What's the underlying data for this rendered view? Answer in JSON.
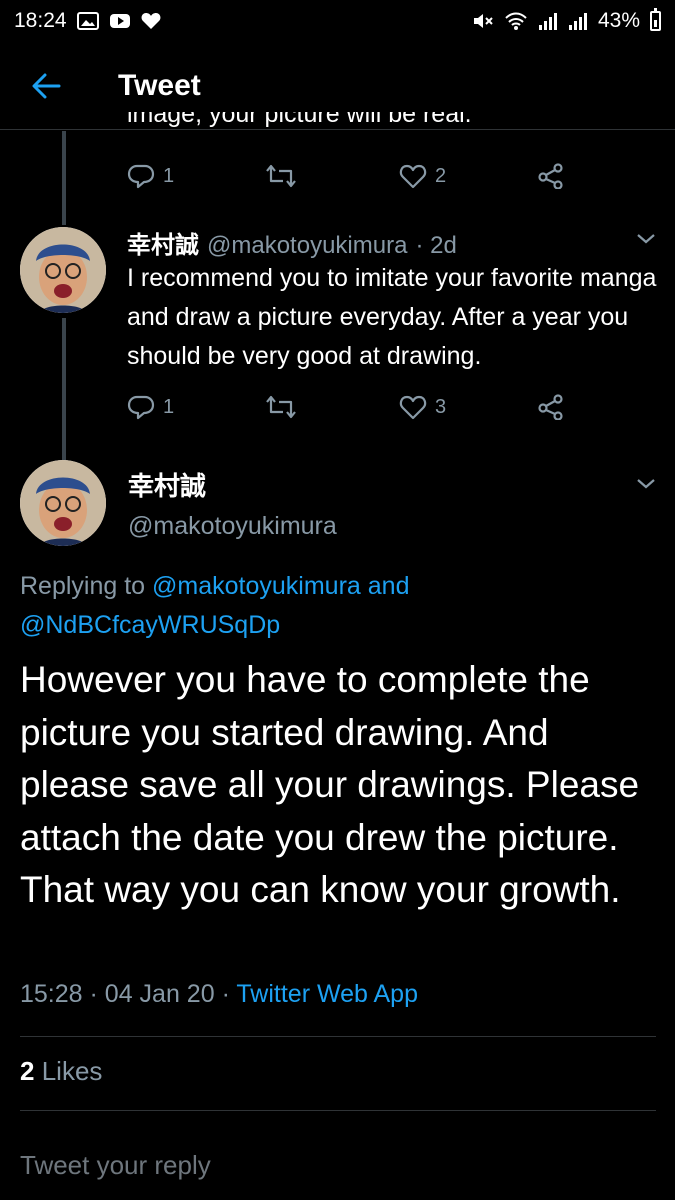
{
  "status_bar": {
    "time": "18:24",
    "battery": "43%",
    "left_icons": [
      "gallery-icon",
      "youtube-icon",
      "heart-icon"
    ],
    "right_icons": [
      "mute-icon",
      "wifi-icon",
      "signal-icon",
      "signal-icon",
      "battery-icon"
    ]
  },
  "header": {
    "title": "Tweet",
    "back_icon": "arrow-left-icon"
  },
  "colors": {
    "background": "#000000",
    "accent": "#1da1f2",
    "secondary_text": "#8899a6",
    "divider": "#2f3336"
  },
  "previous_tweet": {
    "partial_text": "image, your picture will be real.",
    "reply_count": "1",
    "like_count": "2"
  },
  "reply_tweet": {
    "name": "幸村誠",
    "handle": "@makotoyukimura",
    "time": "· 2d",
    "text": "I recommend you to imitate your favorite manga and draw a picture everyday. After a year you should be very good at drawing.",
    "reply_count": "1",
    "like_count": "3"
  },
  "main_tweet": {
    "name": "幸村誠",
    "handle": "@makotoyukimura",
    "replying_prefix": "Replying to",
    "replying_user1": "@makotoyukimura",
    "replying_and": "and",
    "replying_user2": "@NdBCfcayWRUSqDp",
    "text": "However you have to complete the picture you started drawing. And please save all your drawings. Please attach the date you drew the picture. That way you can know your growth.",
    "time": "15:28",
    "date": "04 Jan 20",
    "separator": "·",
    "source": "Twitter Web App",
    "likes_count": "2",
    "likes_label": "Likes"
  },
  "reply_box": {
    "placeholder": "Tweet your reply"
  }
}
